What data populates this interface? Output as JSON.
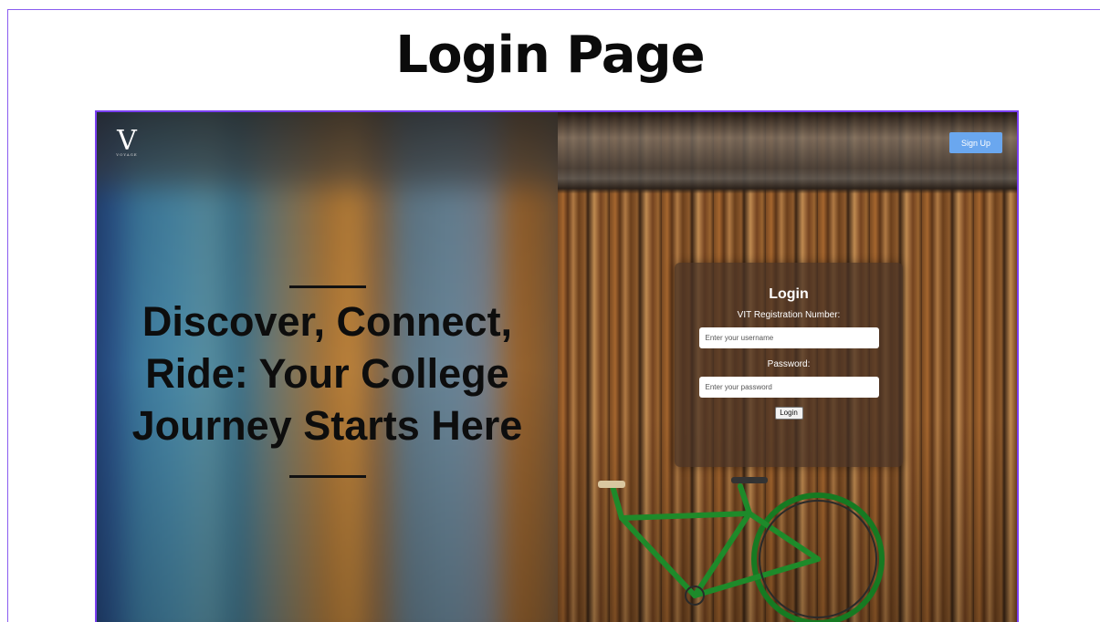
{
  "page": {
    "heading": "Login Page"
  },
  "brand": {
    "logo_letter": "V",
    "logo_subtext": "VOYAGE"
  },
  "hero": {
    "tagline": "Discover, Connect, Ride: Your College Journey Starts Here"
  },
  "header": {
    "signup_label": "Sign Up"
  },
  "login_form": {
    "title": "Login",
    "username_label": "VIT Registration Number:",
    "username_placeholder": "Enter your username",
    "password_label": "Password:",
    "password_placeholder": "Enter your password",
    "submit_label": "Login"
  },
  "colors": {
    "frame_border": "#7a3ff0",
    "signup_button": "#6aa7ef",
    "card_background": "rgba(70,50,38,0.72)"
  }
}
